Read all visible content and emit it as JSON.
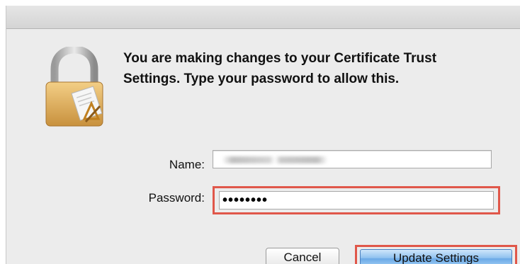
{
  "dialog": {
    "message": "You are making changes to your Certificate Trust Settings. Type your password to allow this.",
    "icon": "lock-certificate-icon"
  },
  "form": {
    "name_label": "Name:",
    "name_value_obscured": true,
    "password_label": "Password:",
    "password_value": "••••••••"
  },
  "buttons": {
    "cancel_label": "Cancel",
    "update_label": "Update Settings"
  },
  "colors": {
    "highlight": "#e0574a",
    "default_button": "#6aa9e6",
    "dialog_background": "#ececec"
  }
}
